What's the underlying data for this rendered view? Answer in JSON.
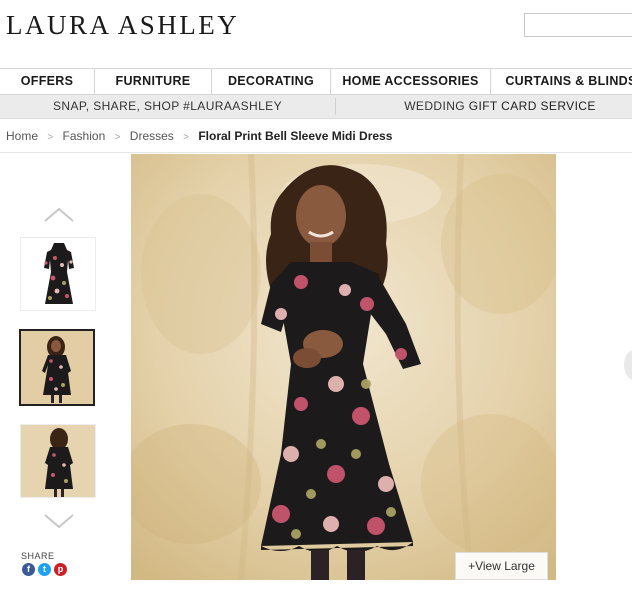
{
  "brand": {
    "logo_text": "LAURA ASHLEY"
  },
  "search": {
    "placeholder": ""
  },
  "main_nav": {
    "items": [
      {
        "label": "OFFERS"
      },
      {
        "label": "FURNITURE"
      },
      {
        "label": "DECORATING"
      },
      {
        "label": "HOME ACCESSORIES"
      },
      {
        "label": "CURTAINS & BLINDS"
      }
    ]
  },
  "sub_nav": {
    "left": {
      "prefix": "SNAP, SHARE, SHOP ",
      "hashtag": "#LAURAASHLEY"
    },
    "right": {
      "prefix": "WEDDING ",
      "highlight": "GIFT CARD SERVICE"
    }
  },
  "breadcrumb": {
    "items": [
      "Home",
      "Fashion",
      "Dresses"
    ],
    "separator": ">",
    "current": "Floral Print Bell Sleeve Midi Dress"
  },
  "gallery": {
    "thumbnails": [
      {
        "name": "front-flat",
        "selected": false
      },
      {
        "name": "model-front",
        "selected": true
      },
      {
        "name": "model-back",
        "selected": false
      }
    ],
    "view_large_label": "+View Large"
  },
  "share": {
    "label": "SHARE",
    "icons": [
      {
        "name": "facebook-icon",
        "glyph": "f",
        "color": "#3b5998"
      },
      {
        "name": "twitter-icon",
        "glyph": "t",
        "color": "#1da1f2"
      },
      {
        "name": "pinterest-icon",
        "glyph": "p",
        "color": "#cb2027"
      }
    ]
  },
  "colors": {
    "backdrop": "#e8d7b4",
    "dress": "#1d1a1c",
    "flower_pink": "#c9566e",
    "flower_light": "#e9b9b5",
    "leaf": "#a8a162",
    "skin": "#8a5a3f",
    "hair": "#3a2416"
  }
}
